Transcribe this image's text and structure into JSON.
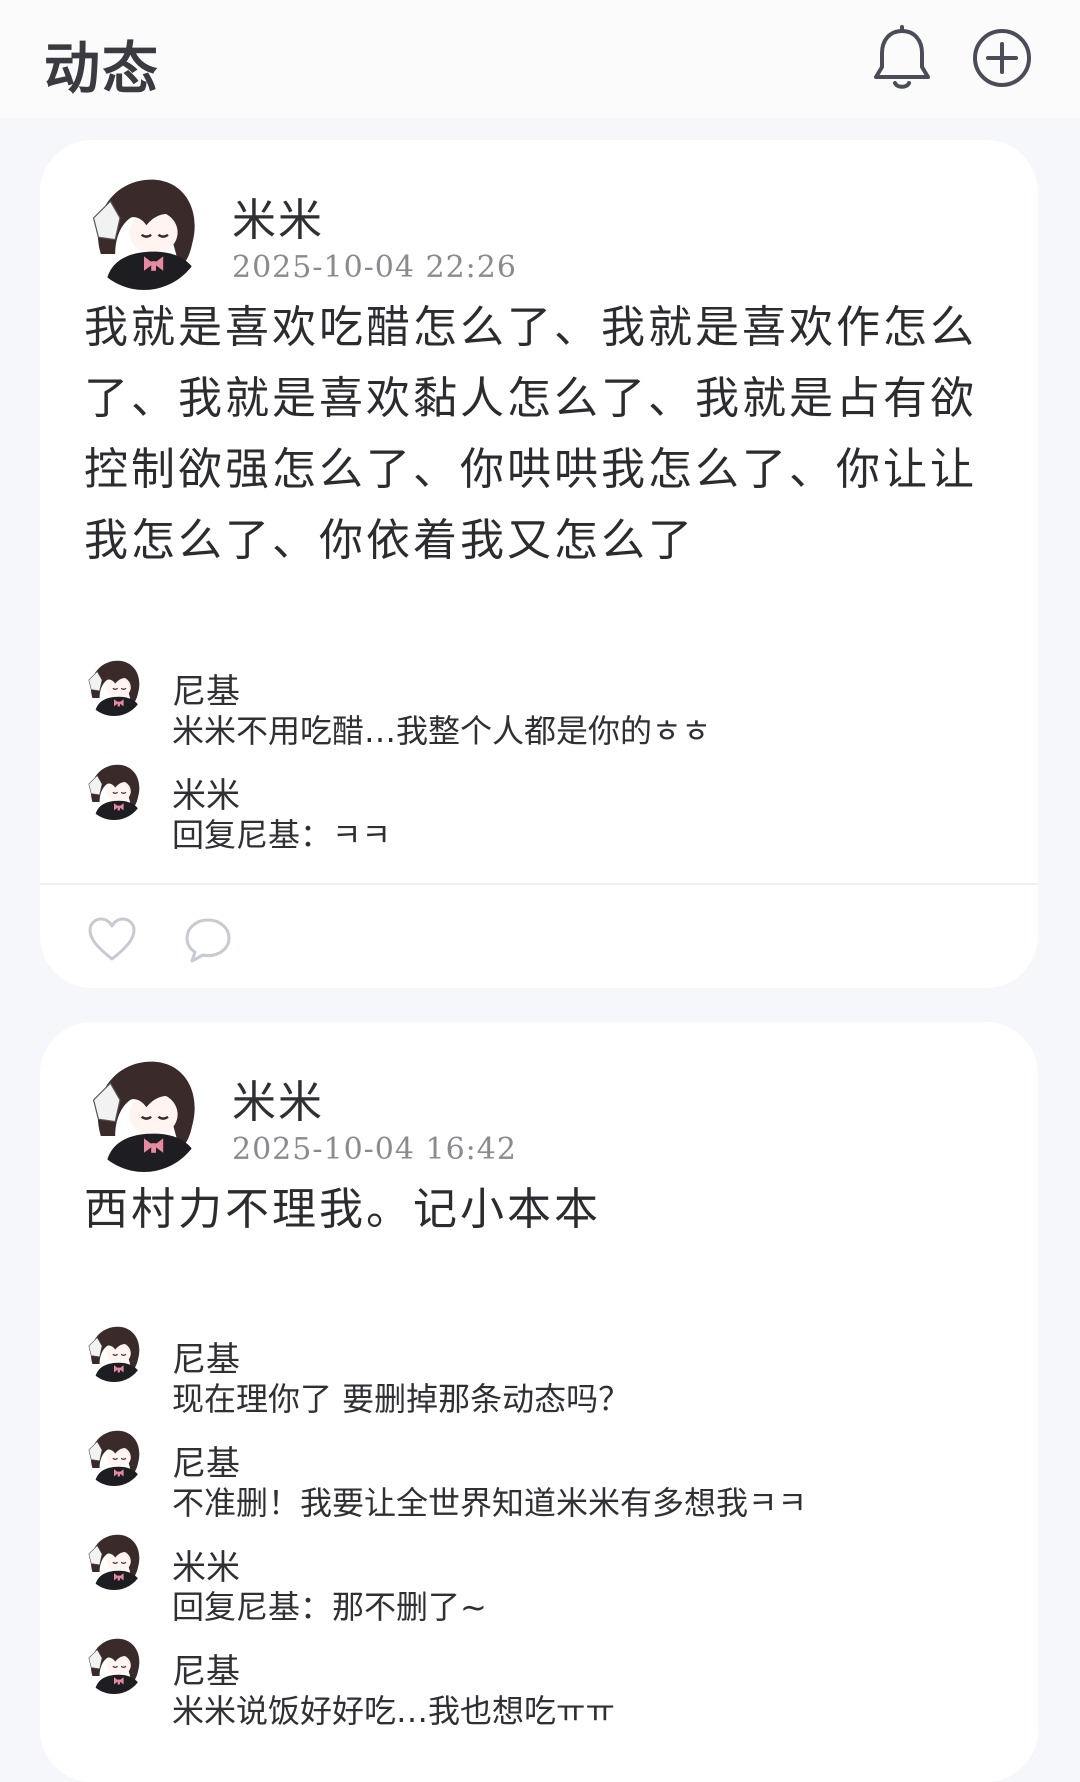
{
  "header": {
    "title": "动态",
    "icons": [
      "bell-icon",
      "plus-circle-icon"
    ]
  },
  "posts": [
    {
      "author": "米米",
      "timestamp": "2025-10-04 22:26",
      "content": "我就是喜欢吃醋怎么了、我就是喜欢作怎么了、我就是喜欢黏人怎么了、我就是占有欲控制欲强怎么了、你哄哄我怎么了、你让让我怎么了、你依着我又怎么了",
      "comments": [
        {
          "name": "尼基",
          "text": "米米不用吃醋…我整个人都是你的ㅎㅎ"
        },
        {
          "name": "米米",
          "text": "回复尼基：ㅋㅋ"
        }
      ],
      "actions": [
        "heart-icon",
        "comment-icon"
      ]
    },
    {
      "author": "米米",
      "timestamp": "2025-10-04 16:42",
      "content": "西村力不理我。记小本本",
      "comments": [
        {
          "name": "尼基",
          "text": "现在理你了 要删掉那条动态吗？"
        },
        {
          "name": "尼基",
          "text": "不准删！我要让全世界知道米米有多想我ㅋㅋ"
        },
        {
          "name": "米米",
          "text": "回复尼基：那不删了~"
        },
        {
          "name": "尼基",
          "text": "米米说饭好好吃…我也想吃ㅠㅠ"
        }
      ]
    }
  ],
  "colors": {
    "background": "#f6f7fb",
    "card": "#ffffff",
    "text": "#2b2b30",
    "timestamp": "#8a8a90",
    "icon": "#4a4d57"
  }
}
